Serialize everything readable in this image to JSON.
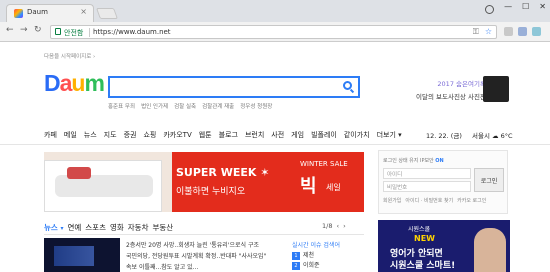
{
  "browser": {
    "tab_title": "Daum",
    "close": "×",
    "secure_label": "안전함",
    "url": "https://www.daum.net",
    "back": "←",
    "forward": "→",
    "reload": "↻",
    "star": "☆"
  },
  "header": {
    "startpage": "다음을 시작페이지로 ›",
    "logo": {
      "d": "D",
      "a": "a",
      "u": "u",
      "m": "m"
    },
    "search_placeholder": "",
    "suggestions": [
      "홍준표 무죄",
      "법인 인가제",
      "검찰 실축",
      "검찰관계 재출",
      "정우성 청원장"
    ],
    "promo_line1": "2017 숨은여기록",
    "promo_line2": "이달의 보도사진상 사진전"
  },
  "nav": {
    "items": [
      "카페",
      "메일",
      "뉴스",
      "지도",
      "증권",
      "쇼핑",
      "카카오TV",
      "웹툰",
      "블로그",
      "브런치",
      "사전",
      "게임",
      "빌폴레이",
      "같이가치",
      "더보기 ▾"
    ],
    "date": "12. 22. (금)",
    "weather_city": "서울시",
    "weather_temp": "6°C"
  },
  "banner": {
    "super_week": "SUPER WEEK ✶",
    "sub": "이불하면 누비지오",
    "winter": "WINTER SALE",
    "big": "빅",
    "big_sub": "세일"
  },
  "login": {
    "opts": "로그인 상태 유지  IP보안",
    "on": "ON",
    "id_placeholder": "아이디",
    "pw_placeholder": "비밀번호",
    "button": "로그인",
    "links": [
      "회원가입",
      "아이디 · 비밀번호 찾기",
      "카카오 로그인"
    ]
  },
  "news": {
    "tabs": [
      "뉴스",
      "연예",
      "스포츠",
      "영화",
      "자동차",
      "부동산"
    ],
    "pager": "1/8",
    "headlines": [
      "2층서만 20명 사망..회생자 늘린 '통유리'으로식 구조",
      "국민의당, 전당원투표 시발계획 확정..반대파 \"사사오입\"",
      "속보 이틀째...참도 알고 있..."
    ],
    "realtime_title": "실시간 이슈 검색어",
    "realtime": [
      {
        "rank": "1",
        "term": "제천"
      },
      {
        "rank": "2",
        "term": "이희준"
      }
    ]
  },
  "ad": {
    "brand": "시원스쿨",
    "new": "NEW",
    "line1": "영어가 안되면",
    "line2": "시원스쿨 스마트!"
  }
}
